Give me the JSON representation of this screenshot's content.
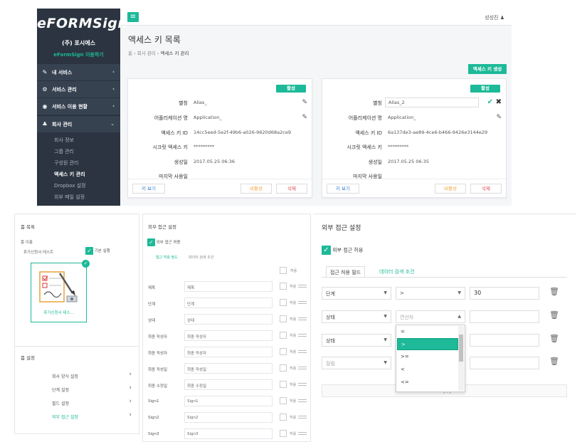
{
  "top": {
    "brand": "eFORMSign",
    "company": "(주) 포시에스",
    "usage_link": "eFormSign 이용하기",
    "menu": [
      {
        "label": "내 서비스",
        "icon": "edit-icon"
      },
      {
        "label": "서비스 관리",
        "icon": "gear-icon"
      },
      {
        "label": "서비스 이용 현황",
        "icon": "dashboard-icon"
      },
      {
        "label": "회사 관리",
        "icon": "org-chart-icon"
      }
    ],
    "submenu": [
      "회사 정보",
      "그룹 관리",
      "구성원 관리",
      "액세스 키 관리",
      "Dropbox 설정",
      "외부 메일 설정"
    ],
    "user": "성성진",
    "page_title": "액세스 키 목록",
    "breadcrumb": {
      "home": "홈",
      "parent": "회사 관리",
      "current": "액세스 키 관리"
    },
    "generate_button": "액세스 키 생성",
    "labels": {
      "alias": "별칭",
      "app_name": "어플리케이션 명",
      "key_id": "액세스 키 ID",
      "secret": "시크릿 액세스 키",
      "created": "생성일",
      "last_used": "마지막 사용일"
    },
    "cards": [
      {
        "status": "활성",
        "alias": "Alias_",
        "app_name": "Application_",
        "key_id": "14cc5eed-5e2f-49b6-a026-9620d68a2ce9",
        "secret": "*********",
        "created": "2017.05.25 06:36",
        "last_used": "",
        "view_key": "키 보기",
        "deactivate": "비활성",
        "delete": "삭제"
      },
      {
        "status": "활성",
        "alias": "Alias_2",
        "app_name": "Application_",
        "key_id": "6a137de3-ae89-4ce6-b466-9426e3144e29",
        "secret": "*********",
        "created": "2017.05.25 06:35",
        "last_used": "",
        "view_key": "키 보기",
        "deactivate": "비활성",
        "delete": "삭제"
      }
    ]
  },
  "form_panel": {
    "title": "폼 목록",
    "name_label": "폼 이름",
    "name_value": "휴가신청서 테스트",
    "default_label": "기본 실행",
    "thumb_label": "휴가신청서 테스...",
    "settings_title": "폼 설정",
    "settings": [
      "회사 양식 설정",
      "단계 설정",
      "필드 설정",
      "외부 접근 설정"
    ]
  },
  "ext_fields": {
    "title": "외부 접근 설정",
    "allow_label": "외부 접근 허용",
    "tab1": "접근 허용 필드",
    "tab2": "데이터 검색 조건",
    "allow_col": "허용",
    "rows": [
      {
        "name": "제목",
        "field": "제목"
      },
      {
        "name": "단계",
        "field": "단계"
      },
      {
        "name": "상태",
        "field": "상태"
      },
      {
        "name": "최종 작성자",
        "field": "최종 작성자"
      },
      {
        "name": "최종 작성자",
        "field": "최종 작성자"
      },
      {
        "name": "최종 작성일",
        "field": "최종 작성일"
      },
      {
        "name": "최종 수정일",
        "field": "최종 수정일"
      },
      {
        "name": "Sign1",
        "field": "Sign1"
      },
      {
        "name": "Sign2",
        "field": "Sign2"
      },
      {
        "name": "Sign3",
        "field": "Sign3"
      }
    ]
  },
  "conditions": {
    "title": "외부 접근 설정",
    "allow_label": "외부 접근 허용",
    "tab1": "접근 허용 필드",
    "tab2": "데이터 검색 조건",
    "rows": [
      {
        "field": "단계",
        "op": ">",
        "value": "30"
      },
      {
        "field": "상태",
        "op": "연산자",
        "value": ""
      },
      {
        "field": "상태",
        "op": "",
        "value": ""
      },
      {
        "field": "컬럼",
        "op": "",
        "value": ""
      }
    ],
    "operators": [
      "=",
      ">",
      ">=",
      "<",
      "<="
    ],
    "selected_operator": ">",
    "add_link": "추가"
  }
}
